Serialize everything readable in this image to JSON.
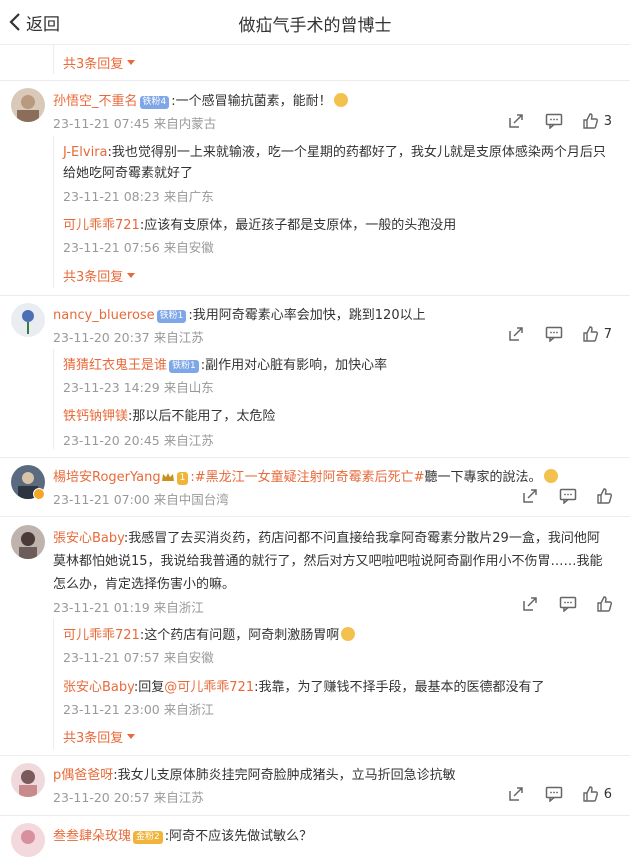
{
  "header": {
    "back_label": "返回",
    "title": "做疝气手术的曾博士"
  },
  "thread0": {
    "more_label": "共3条回复"
  },
  "c1": {
    "name": "孙悟空_不重名",
    "badge": "铁粉4",
    "text": ":一个感冒输抗菌素，能耐！",
    "meta": "23-11-21 07:45 来自内蒙古",
    "likes": "3",
    "replies": [
      {
        "name": "J-Elvira",
        "text1": ":我也觉得别一上来就输液，吃一个星期的药都好了，我女儿就是支原体感染两个月后只",
        "text2": "给她吃阿奇霉素就好了",
        "meta": "23-11-21 08:23 来自广东"
      },
      {
        "name": "可儿乖乖721",
        "text1": ":应该有支原体，最近孩子都是支原体，一般的头孢没用",
        "meta": "23-11-21 07:56 来自安徽"
      }
    ],
    "more_label": "共3条回复"
  },
  "c2": {
    "name": "nancy_bluerose",
    "badge": "铁粉1",
    "text": ":我用阿奇霉素心率会加快，跳到120以上",
    "meta": "23-11-20 20:37 来自江苏",
    "likes": "7",
    "replies": [
      {
        "name": "猜猜红衣鬼王是谁",
        "badge": "铁粉1",
        "text1": ":副作用对心脏有影响，加快心率",
        "meta": "23-11-23 14:29 来自山东"
      },
      {
        "name": "铁钙钠钾镁",
        "text1": ":那以后不能用了，太危险",
        "meta": "23-11-20 20:45 来自江苏"
      }
    ]
  },
  "c3": {
    "name": "楊培安RogerYang",
    "badge": "1",
    "topic": ":#黑龙江一女童疑注射阿奇霉素后死亡#",
    "text": "聽一下專家的說法。",
    "meta": "23-11-21 07:00 来自中国台湾"
  },
  "c4": {
    "name": "張安心Baby",
    "text1": ":我感冒了去买消炎药，药店问都不问直接给我拿阿奇霉素分散片29一盒，我问他阿",
    "text2": "莫林都怕她说15，我说给我普通的就行了，然后对方又吧啦吧啦说阿奇副作用小不伤胃……我能",
    "text3": "怎么办，肯定选择伤害小的嘛。",
    "meta": "23-11-21 01:19 来自浙江",
    "replies": [
      {
        "name": "可儿乖乖721",
        "text1": ":这个药店有问题，阿奇刺激肠胃啊",
        "meta": "23-11-21 07:57 来自安徽"
      },
      {
        "name": "张安心Baby",
        "reply_prefix": ":回复",
        "reply_to": "@可儿乖乖721",
        "text1": ":我靠，为了赚钱不择手段，最基本的医德都没有了",
        "meta": "23-11-21 23:00 来自浙江"
      }
    ],
    "more_label": "共3条回复"
  },
  "c5": {
    "name": "p偶爸爸呀",
    "text": ":我女儿支原体肺炎挂完阿奇脸肿成猪头，立马折回急诊抗敏",
    "meta": "23-11-20 20:57 来自江苏",
    "likes": "6"
  },
  "c6": {
    "name": "叁叁肆朵玫瑰",
    "badge": "金粉2",
    "text": ":阿奇不应该先做试敏么？"
  },
  "icons": [
    "chevron-left-icon",
    "share-icon",
    "comment-icon",
    "like-icon",
    "verified-icon"
  ],
  "colors": {
    "accent": "#e86a3a",
    "meta": "#999999",
    "text": "#333333",
    "badge": "#7fa6e6"
  }
}
